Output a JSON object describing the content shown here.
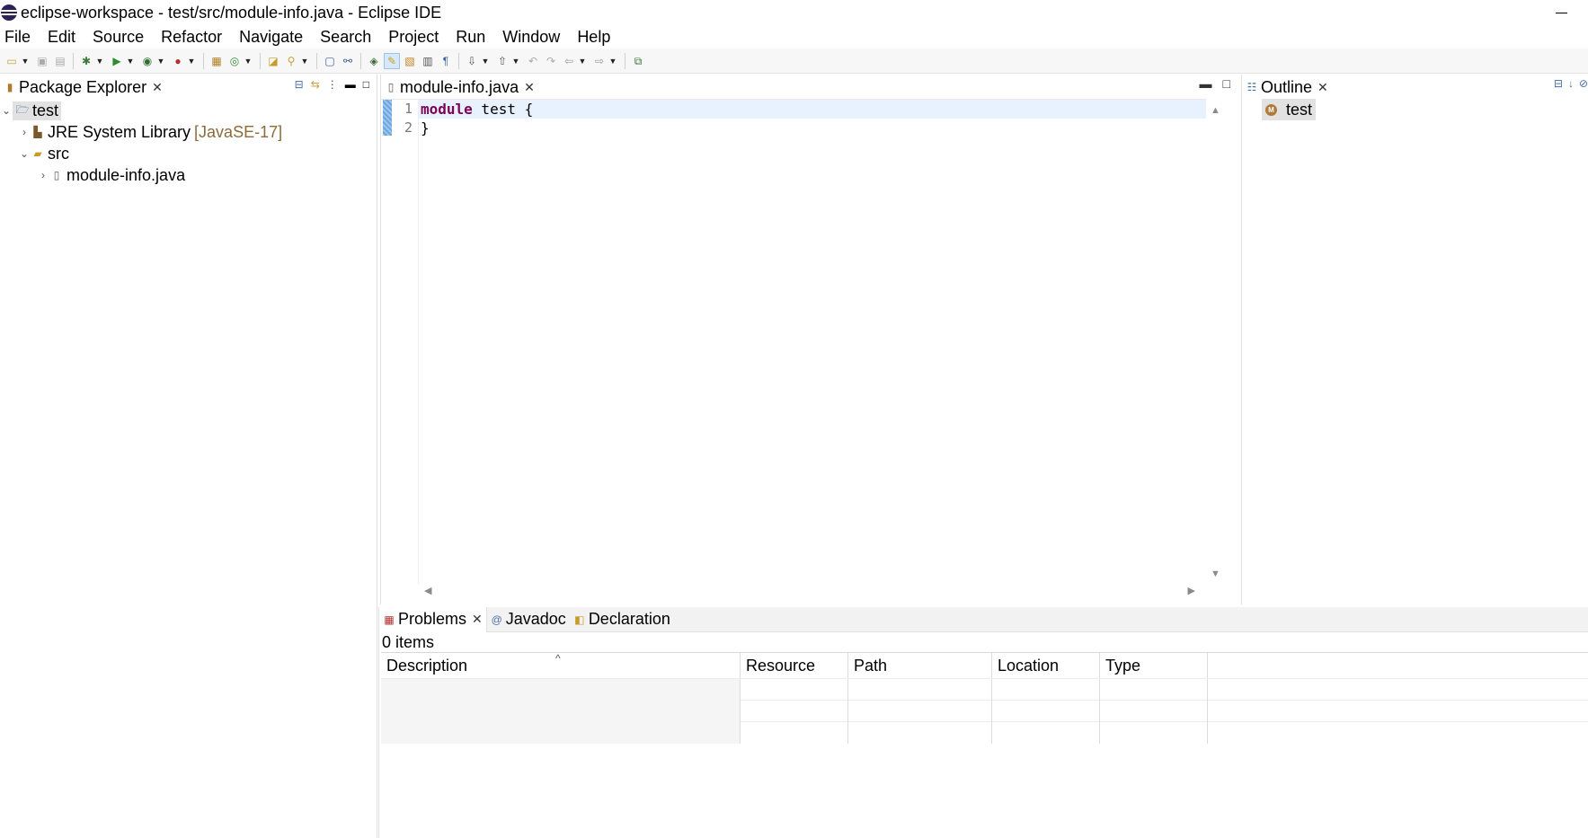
{
  "window": {
    "title": "eclipse-workspace - test/src/module-info.java - Eclipse IDE"
  },
  "menu": [
    "File",
    "Edit",
    "Source",
    "Refactor",
    "Navigate",
    "Search",
    "Project",
    "Run",
    "Window",
    "Help"
  ],
  "package_explorer": {
    "tab_label": "Package Explorer",
    "tree": {
      "project": "test",
      "jre_label": "JRE System Library",
      "jre_decoration": "[JavaSE-17]",
      "src_label": "src",
      "file_label": "module-info.java"
    }
  },
  "editor": {
    "tab_label": "module-info.java",
    "line_numbers": [
      "1",
      "2"
    ],
    "line1": {
      "keyword": "module",
      "rest": " test {"
    },
    "line2": "}"
  },
  "outline": {
    "tab_label": "Outline",
    "item_label": "test",
    "item_icon_glyph": "M"
  },
  "bottom_panel": {
    "tabs": {
      "problems": "Problems",
      "javadoc": "Javadoc",
      "declaration": "Declaration"
    },
    "items_count": "0 items",
    "columns": {
      "description": "Description",
      "resource": "Resource",
      "path": "Path",
      "location": "Location",
      "type": "Type"
    },
    "sort_indicator": "^"
  },
  "colors": {
    "keyword": "#7f0055",
    "current_line": "#e8f2fe",
    "jre_decoration": "#8a6c3a",
    "selection": "#e2e2e2"
  }
}
